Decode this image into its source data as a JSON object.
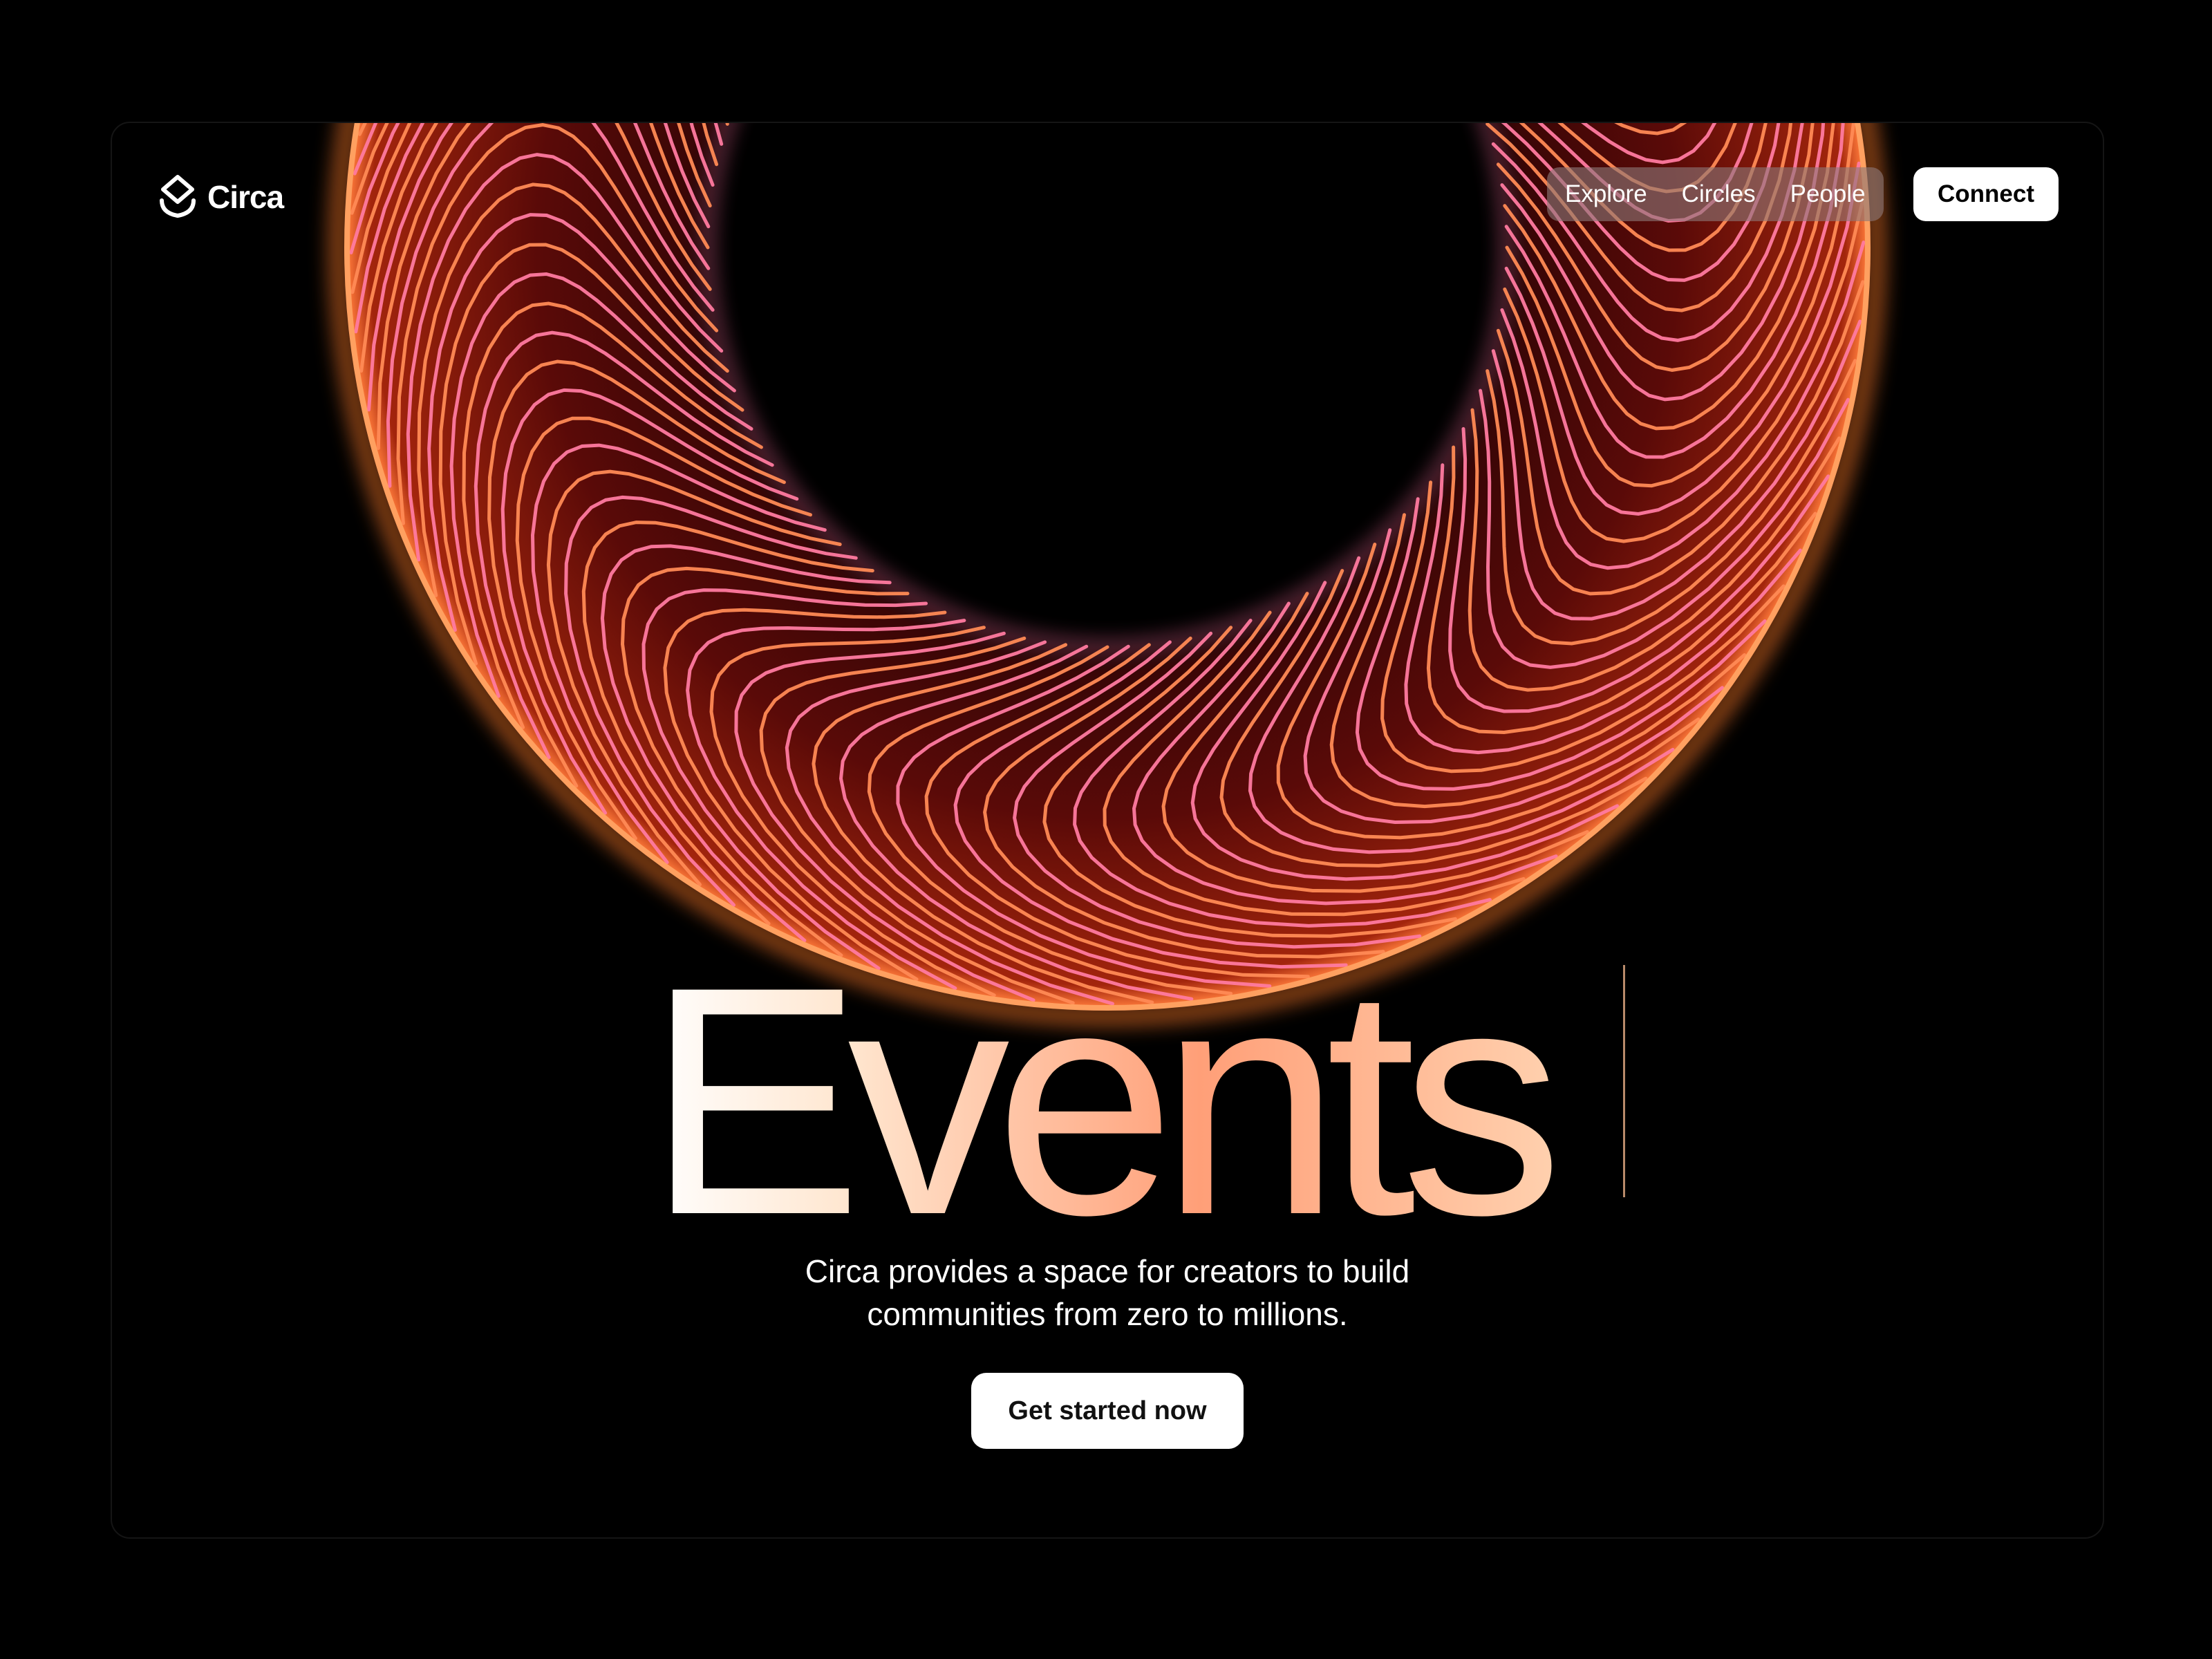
{
  "brand": {
    "name": "Circa",
    "logo_icon": "layers-stack-icon"
  },
  "nav": {
    "links": [
      "Explore",
      "Circles",
      "People"
    ],
    "connect_label": "Connect"
  },
  "hero": {
    "headline": "Events",
    "subtitle_line1": "Circa provides a space for creators to build",
    "subtitle_line2": "communities from zero to millions.",
    "cta_label": "Get started now"
  },
  "colors": {
    "background": "#000000",
    "ring_inner": "#ff6f9c",
    "ring_outer": "#ff9a4a",
    "button_bg": "#ffffff"
  }
}
